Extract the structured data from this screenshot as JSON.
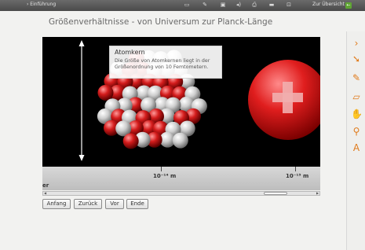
{
  "header": {
    "breadcrumb": "› Einführung",
    "overview_label": "Zur Übersicht",
    "icons": [
      "card-icon",
      "edit-icon",
      "screen-icon",
      "speaker-icon",
      "print-icon",
      "media-icon",
      "fullscreen-icon",
      "overview-arrow-icon"
    ]
  },
  "page": {
    "title": "Größenverhältnisse - von Universum zur Planck-Länge"
  },
  "callout": {
    "title": "Atomkern",
    "text": "Die Größe von Atomkernen liegt in der Größenordnung von 10 Femtometern."
  },
  "scale": {
    "ticks": [
      "10⁻¹⁴ m",
      "10⁻¹⁵ m"
    ],
    "partial_label": "er"
  },
  "nav": {
    "start": "Anfang",
    "back": "Zurück",
    "forward": "Vor",
    "end": "Ende"
  },
  "toolbar": {
    "tools": [
      "chevron-right-icon",
      "pointer-icon",
      "pencil-icon",
      "eraser-icon",
      "hand-icon",
      "magnifier-icon",
      "text-icon"
    ]
  },
  "colors": {
    "accent": "#e07a1a",
    "proton": "#c81818",
    "neutron": "#cfcfcf",
    "background": "#000000"
  }
}
